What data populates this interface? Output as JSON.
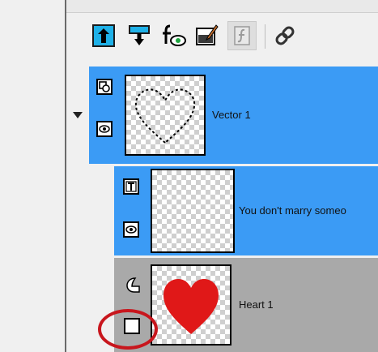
{
  "toolbar": {
    "buttons": [
      {
        "name": "move-layer-up",
        "icon": "arrow-up-icon"
      },
      {
        "name": "move-layer-down",
        "icon": "arrow-down-icon"
      },
      {
        "name": "layer-effects",
        "icon": "fx-icon"
      },
      {
        "name": "layer-style",
        "icon": "brush-icon"
      },
      {
        "name": "layer-function",
        "icon": "function-icon",
        "state": "disabled"
      },
      {
        "name": "link-layers",
        "icon": "link-icon"
      }
    ]
  },
  "layers": [
    {
      "name": "Vector 1",
      "type": "vector",
      "selected": true,
      "expanded": true,
      "visible": true
    },
    {
      "name": "You don't marry someo",
      "type": "text",
      "selected": true,
      "visible": true
    },
    {
      "name": "Heart 1",
      "type": "shape",
      "selected": false,
      "visible": false
    }
  ],
  "colors": {
    "selection": "#3b9bf5",
    "unselected": "#a9a9a9",
    "heart": "#e01818",
    "highlight_circle": "#c8161d"
  }
}
